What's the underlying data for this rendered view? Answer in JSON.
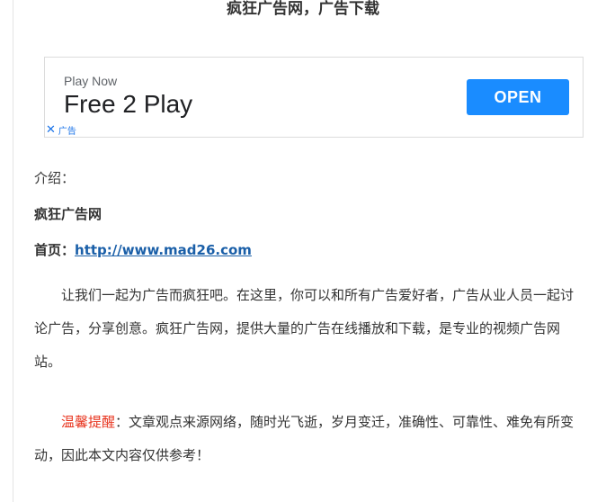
{
  "article": {
    "title": "疯狂广告网，广告下载",
    "intro_label": "介绍：",
    "site_name": "疯狂广告网",
    "home_label": "首页：",
    "home_url": "http://www.mad26.com",
    "paragraph1": "让我们一起为广告而疯狂吧。在这里，你可以和所有广告爱好者，广告从业人员一起讨论广告，分享创意。疯狂广告网，提供大量的广告在线播放和下载，是专业的视频广告网站。",
    "warning_label": "温馨提醒",
    "warning_text": "：文章观点来源网络，随时光飞逝，岁月变迁，准确性、可靠性、难免有所变动，因此本文内容仅供参考！"
  },
  "ad": {
    "subtitle": "Play Now",
    "headline": "Free 2 Play",
    "button_label": "OPEN",
    "choices_label": "广告",
    "button_color": "#1a8cff"
  }
}
